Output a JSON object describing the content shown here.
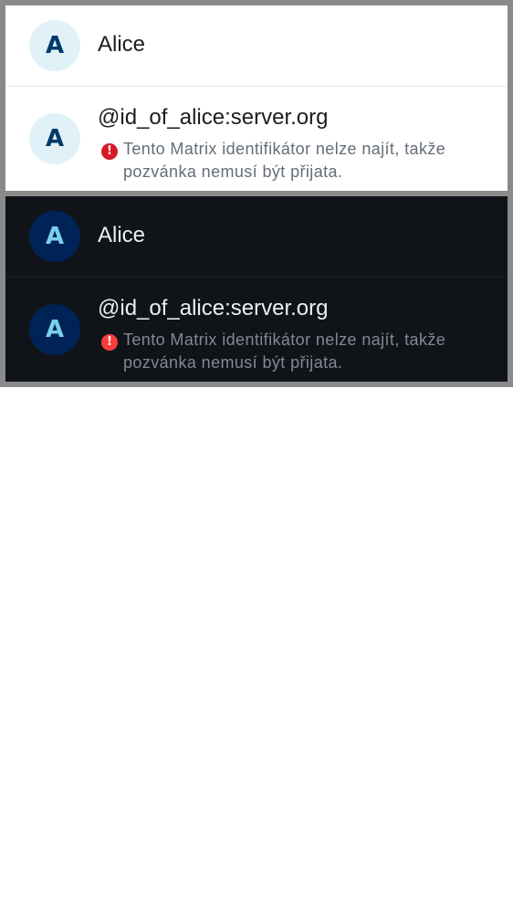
{
  "light": {
    "contact": {
      "avatar_initial": "A",
      "name": "Alice"
    },
    "invite": {
      "avatar_initial": "A",
      "user_id": "@id_of_alice:server.org",
      "error_icon": "alert-circle-icon",
      "warning_line1": "Tento Matrix identifikátor nelze najít, takže",
      "warning_line2": "pozvánka nemusí být přijata."
    }
  },
  "dark": {
    "contact": {
      "avatar_initial": "A",
      "name": "Alice"
    },
    "invite": {
      "avatar_initial": "A",
      "user_id": "@id_of_alice:server.org",
      "error_icon": "alert-circle-icon",
      "warning_line1": "Tento Matrix identifikátor nelze najít, takže",
      "warning_line2": "pozvánka nemusí být přijata."
    }
  },
  "colors": {
    "light_avatar_bg": "#e0f2f7",
    "light_avatar_fg": "#003a6b",
    "dark_avatar_bg": "#002357",
    "dark_avatar_fg": "#7ad0e8",
    "light_error": "#d51928",
    "dark_error": "#fd3e3c"
  }
}
